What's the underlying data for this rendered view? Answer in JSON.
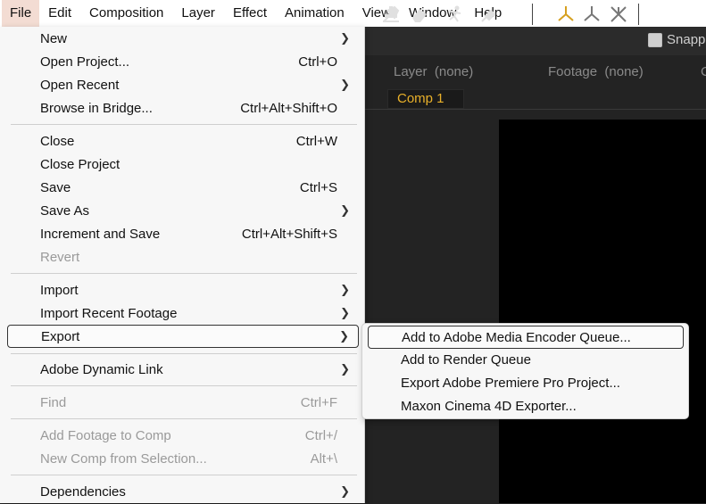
{
  "menubar": [
    "File",
    "Edit",
    "Composition",
    "Layer",
    "Effect",
    "Animation",
    "View",
    "Window",
    "Help"
  ],
  "toolbar": {
    "snapping_label": "Snappi"
  },
  "panels": {
    "layer_label": "Layer",
    "layer_value": "(none)",
    "footage_label": "Footage",
    "footage_value": "(none)",
    "edge_char": "C",
    "comp_tab": "Comp 1"
  },
  "file_menu": {
    "new": {
      "label": "New"
    },
    "open_project": {
      "label": "Open Project...",
      "shortcut": "Ctrl+O"
    },
    "open_recent": {
      "label": "Open Recent"
    },
    "browse_bridge": {
      "label": "Browse in Bridge...",
      "shortcut": "Ctrl+Alt+Shift+O"
    },
    "close": {
      "label": "Close",
      "shortcut": "Ctrl+W"
    },
    "close_project": {
      "label": "Close Project"
    },
    "save": {
      "label": "Save",
      "shortcut": "Ctrl+S"
    },
    "save_as": {
      "label": "Save As"
    },
    "increment_save": {
      "label": "Increment and Save",
      "shortcut": "Ctrl+Alt+Shift+S"
    },
    "revert": {
      "label": "Revert"
    },
    "import": {
      "label": "Import"
    },
    "import_recent": {
      "label": "Import Recent Footage"
    },
    "export": {
      "label": "Export"
    },
    "dynamic_link": {
      "label": "Adobe Dynamic Link"
    },
    "find": {
      "label": "Find",
      "shortcut": "Ctrl+F"
    },
    "add_footage": {
      "label": "Add Footage to Comp",
      "shortcut": "Ctrl+/"
    },
    "new_comp_sel": {
      "label": "New Comp from Selection...",
      "shortcut": "Alt+\\"
    },
    "dependencies": {
      "label": "Dependencies"
    }
  },
  "export_submenu": {
    "ame_queue": "Add to Adobe Media Encoder Queue...",
    "render_queue": "Add to Render Queue",
    "premiere_export": "Export Adobe Premiere Pro Project...",
    "cinema4d": "Maxon Cinema 4D Exporter..."
  },
  "colors": {
    "comp_tab_text": "#e8b02a",
    "menu_bg": "#f7f7f7",
    "app_bg": "#232323"
  }
}
